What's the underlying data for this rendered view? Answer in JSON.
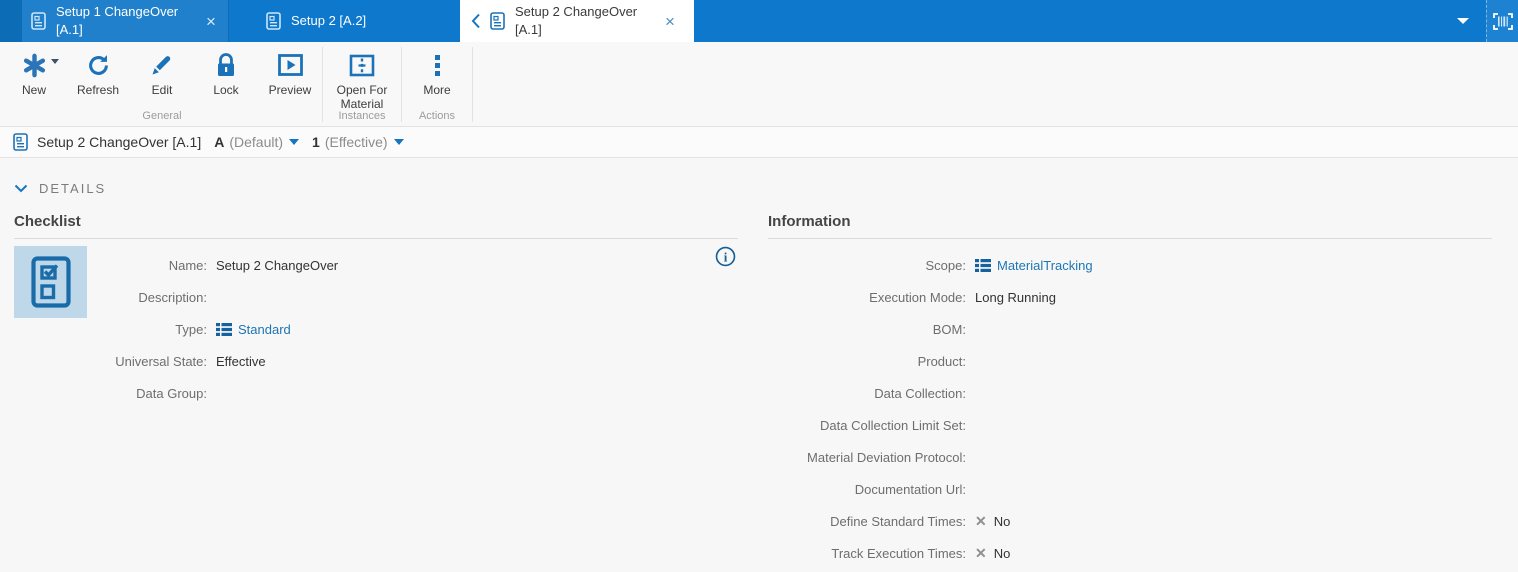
{
  "icons": {
    "tab_close": "×",
    "no_mark": "✕",
    "back_chevron": "‹",
    "caret_down": "▼",
    "more_ellipsis": "⋮",
    "new_asterisk": "✱"
  },
  "colors": {
    "topbar_blue": "#0e78cc",
    "tab_inactive_alt_blue": "#2080cb",
    "icon_blue": "#1c72b8",
    "link_blue": "#1d76b5",
    "thumbnail_bg": "#bed8ea",
    "label_gray": "#6e6e6e",
    "value_dark": "#333333"
  },
  "topbar": {
    "tabs": [
      {
        "title": "Setup 1 ChangeOver [A.1]"
      },
      {
        "title": "Setup 2 [A.2]"
      },
      {
        "title": "Setup 2 ChangeOver [A.1]"
      }
    ]
  },
  "toolbar": {
    "groups": [
      {
        "label": "General",
        "buttons": [
          {
            "label": "New"
          },
          {
            "label": "Refresh"
          },
          {
            "label": "Edit"
          },
          {
            "label": "Lock"
          },
          {
            "label": "Preview"
          }
        ]
      },
      {
        "label": "Instances",
        "buttons": [
          {
            "label": "Open For Material"
          }
        ]
      },
      {
        "label": "Actions",
        "buttons": [
          {
            "label": "More"
          }
        ]
      }
    ]
  },
  "breadcrumb": {
    "title": "Setup 2 ChangeOver [A.1]",
    "version": "A",
    "version_qualifier": "(Default)",
    "revision": "1",
    "revision_qualifier": "(Effective)"
  },
  "details": {
    "header": "DETAILS"
  },
  "checklist": {
    "heading": "Checklist",
    "fields": [
      {
        "label": "Name:",
        "value": "Setup 2 ChangeOver"
      },
      {
        "label": "Description:",
        "value": ""
      },
      {
        "label": "Type:",
        "value": "Standard"
      },
      {
        "label": "Universal State:",
        "value": "Effective"
      },
      {
        "label": "Data Group:",
        "value": ""
      }
    ]
  },
  "information": {
    "heading": "Information",
    "fields": [
      {
        "label": "Scope:",
        "value": "MaterialTracking"
      },
      {
        "label": "Execution Mode:",
        "value": "Long Running"
      },
      {
        "label": "BOM:",
        "value": ""
      },
      {
        "label": "Product:",
        "value": ""
      },
      {
        "label": "Data Collection:",
        "value": ""
      },
      {
        "label": "Data Collection Limit Set:",
        "value": ""
      },
      {
        "label": "Material Deviation Protocol:",
        "value": ""
      },
      {
        "label": "Documentation Url:",
        "value": ""
      },
      {
        "label": "Define Standard Times:",
        "value": "No"
      },
      {
        "label": "Track Execution Times:",
        "value": "No"
      }
    ]
  }
}
